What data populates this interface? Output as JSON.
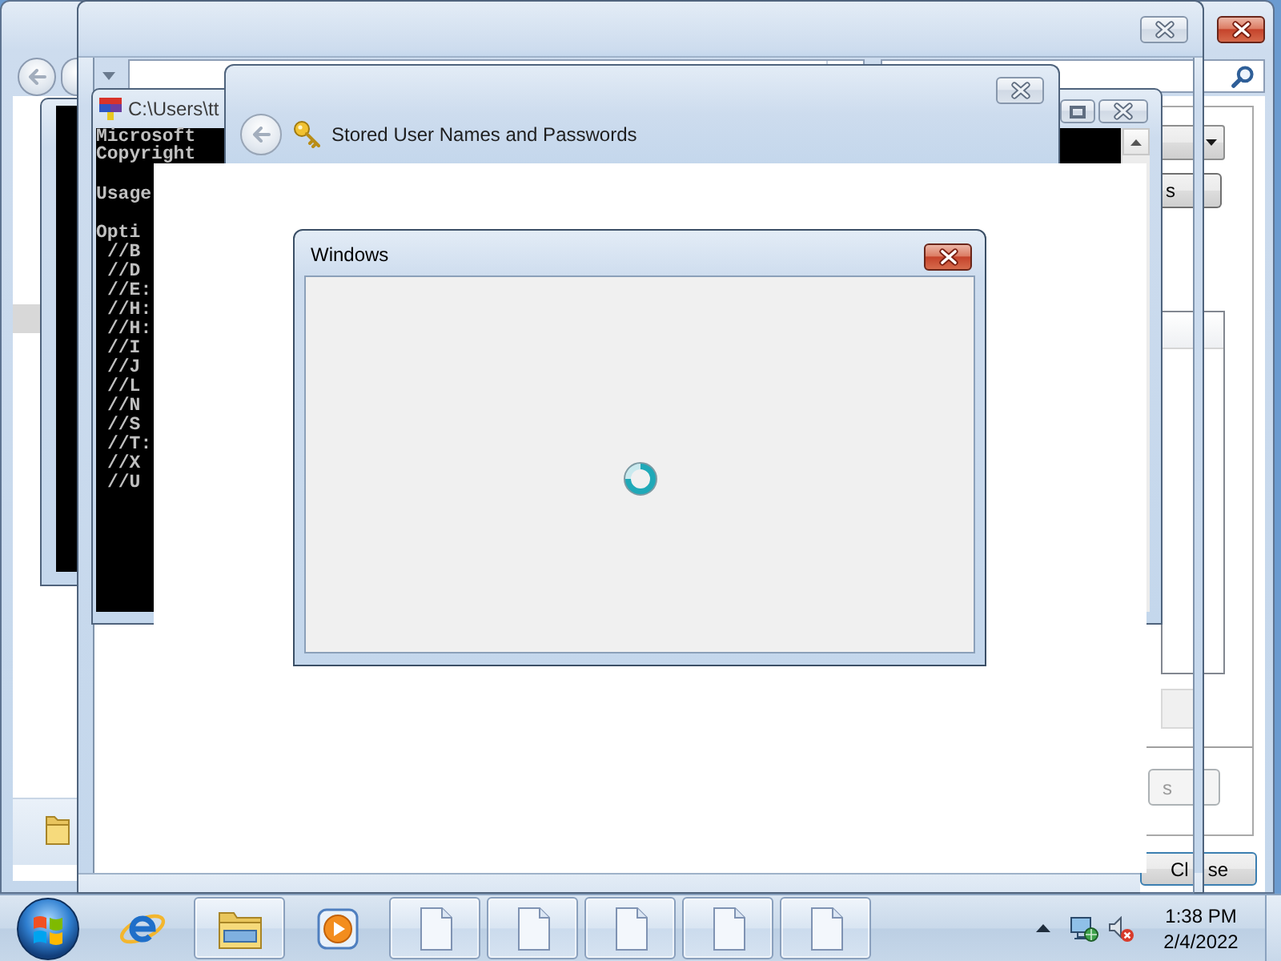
{
  "explorer_window": {
    "active": true
  },
  "rear_dialog": {
    "upper_button": {
      "label": "s",
      "disabled": false
    },
    "lower_button": {
      "label": "s",
      "disabled": true
    },
    "close_button": {
      "label_parts": [
        "Cl",
        "se"
      ]
    }
  },
  "frame_window": {
    "active": false
  },
  "console_window": {
    "active": false,
    "title": "C:\\Users\\tt",
    "header_lines": [
      "Microsoft",
      "Copyright"
    ],
    "usage_line": "Usage",
    "options_heading": "Opti",
    "options": [
      "//B",
      "//D",
      "//E:",
      "//H:",
      "//H:",
      "//I",
      "//J",
      "//L",
      "//N",
      "//S",
      "//T:",
      "//X",
      "//U"
    ]
  },
  "credentials_window": {
    "active": false,
    "title": "Stored User Names and Passwords"
  },
  "message_dialog": {
    "active": true,
    "title": "Windows",
    "busy": true
  },
  "taskbar": {
    "buttons": [
      {
        "kind": "browser",
        "running": false
      },
      {
        "kind": "folder",
        "running": true
      },
      {
        "kind": "media",
        "running": false
      },
      {
        "kind": "document",
        "running": true
      },
      {
        "kind": "document",
        "running": true
      },
      {
        "kind": "document",
        "running": true
      },
      {
        "kind": "document",
        "running": true
      },
      {
        "kind": "document",
        "running": true
      }
    ],
    "clock": {
      "time": "1:38 PM",
      "date": "2/4/2022"
    }
  }
}
